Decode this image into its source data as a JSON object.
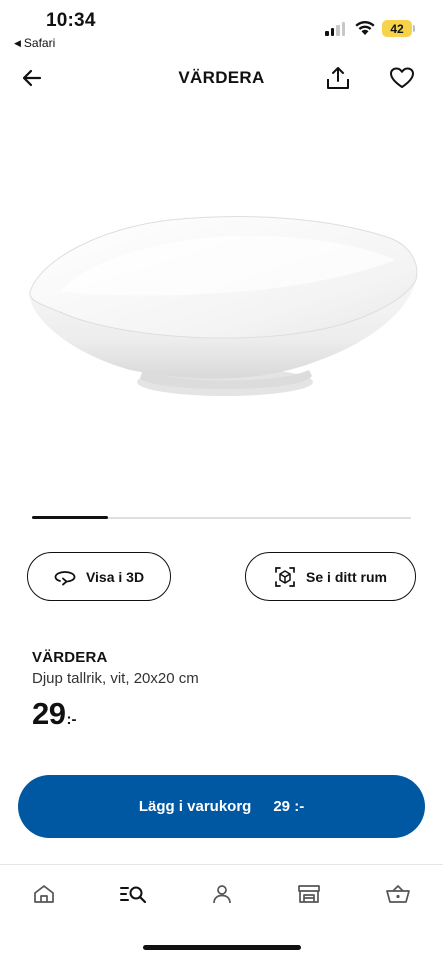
{
  "status_bar": {
    "time": "10:34",
    "back_app": "Safari",
    "battery": "42",
    "battery_color": "#f6d34a"
  },
  "nav": {
    "title": "VÄRDERA",
    "icons": [
      "arrow-left-icon",
      "share-icon",
      "heart-icon"
    ]
  },
  "gallery": {
    "current_index_fraction": 0.2
  },
  "actions": {
    "view_3d_label": "Visa i 3D",
    "view_in_room_label": "Se i ditt rum"
  },
  "product": {
    "name": "VÄRDERA",
    "description": "Djup tallrik, vit, 20x20 cm",
    "price_integer": "29",
    "price_suffix": ":-"
  },
  "cta": {
    "label": "Lägg i varukorg",
    "price": "29 :-",
    "color": "#0058a3"
  },
  "tabbar": {
    "items": [
      "home-icon",
      "search-list-icon",
      "profile-icon",
      "store-icon",
      "basket-icon"
    ]
  }
}
